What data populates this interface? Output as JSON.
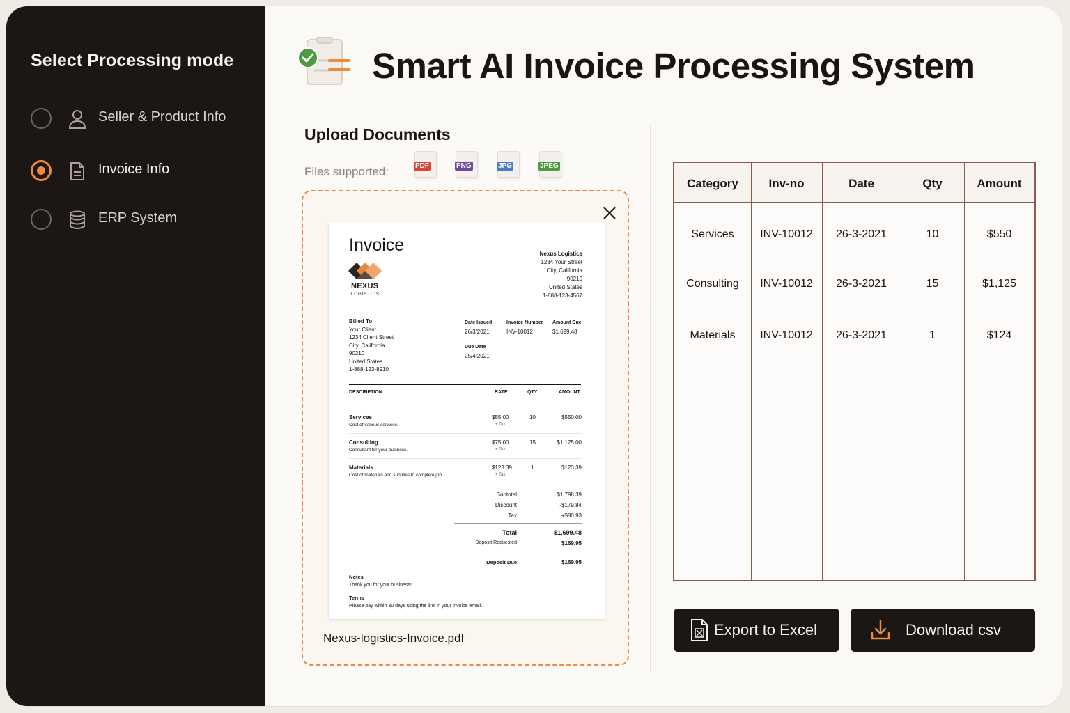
{
  "sidebar": {
    "title": "Select Processing mode",
    "items": [
      {
        "label": "Seller & Product Info",
        "icon": "user-icon",
        "selected": false
      },
      {
        "label": "Invoice Info",
        "icon": "document-icon",
        "selected": true
      },
      {
        "label": "ERP System",
        "icon": "database-icon",
        "selected": false
      }
    ]
  },
  "header": {
    "title": "Smart AI Invoice Processing System",
    "icon": "checklist-icon"
  },
  "upload": {
    "title": "Upload Documents",
    "files_label": "Files supported:",
    "file_types": [
      "PDF",
      "PNG",
      "JPG",
      "JPEG"
    ],
    "filename": "Nexus-logistics-Invoice.pdf"
  },
  "invoice": {
    "title": "Invoice",
    "brand": "NEXUS",
    "brand_sub": "LOGISTICS",
    "company": [
      "Nexus Logistics",
      "1234 Your Street",
      "City, California",
      "90210",
      "United States",
      "1-888-123-4567"
    ],
    "billed_to": [
      "Billed To",
      "Your Client",
      "1234 Client Street",
      "City, California",
      "90210",
      "United States",
      "1-888-123-8910"
    ],
    "date_issued_label": "Date Issued",
    "date_issued": "26/3/2021",
    "invoice_number_label": "Invoice Number",
    "invoice_number": "INV-10012",
    "amount_due_label": "Amount Due",
    "amount_due": "$1,699.48",
    "due_date_label": "Due Date",
    "due_date": "25/4/2021",
    "headers": {
      "description": "DESCRIPTION",
      "rate": "RATE",
      "qty": "QTY",
      "amount": "AMOUNT"
    },
    "items": [
      {
        "name": "Services",
        "desc": "Cost of various services.",
        "rate": "$55.00",
        "tax": "+ Tax",
        "qty": "10",
        "amount": "$550.00"
      },
      {
        "name": "Consulting",
        "desc": "Consultant for your business.",
        "rate": "$75.00",
        "tax": "+ Tax",
        "qty": "15",
        "amount": "$1,125.00"
      },
      {
        "name": "Materials",
        "desc": "Cost of materials and supplies to complete job.",
        "rate": "$123.39",
        "tax": "+ Tax",
        "qty": "1",
        "amount": "$123.39"
      }
    ],
    "subtotal_label": "Subtotal",
    "subtotal": "$1,798.39",
    "discount_label": "Discount",
    "discount": "-$179.84",
    "tax_label": "Tax",
    "tax": "+$80.93",
    "total_label": "Total",
    "total": "$1,699.48",
    "deposit_req_label": "Deposit Requested",
    "deposit_req": "$169.95",
    "deposit_due_label": "Deposit Due",
    "deposit_due": "$169.95",
    "notes_label": "Notes",
    "notes": "Thank you for your business!",
    "terms_label": "Terms",
    "terms": "Please pay within 30 days using the link in your invoice email."
  },
  "table": {
    "headers": [
      "Category",
      "Inv-no",
      "Date",
      "Qty",
      "Amount"
    ],
    "rows": [
      [
        "Services",
        "INV-10012",
        "26-3-2021",
        "10",
        "$550"
      ],
      [
        "Consulting",
        "INV-10012",
        "26-3-2021",
        "15",
        "$1,125"
      ],
      [
        "Materials",
        "INV-10012",
        "26-3-2021",
        "1",
        "$124"
      ]
    ]
  },
  "buttons": {
    "export": "Export to Excel",
    "download": "Download csv"
  },
  "colors": {
    "accent": "#ee8a3c",
    "sidebar": "#1c1714",
    "table_border": "#8b5c4a",
    "check": "#4e9a43"
  }
}
